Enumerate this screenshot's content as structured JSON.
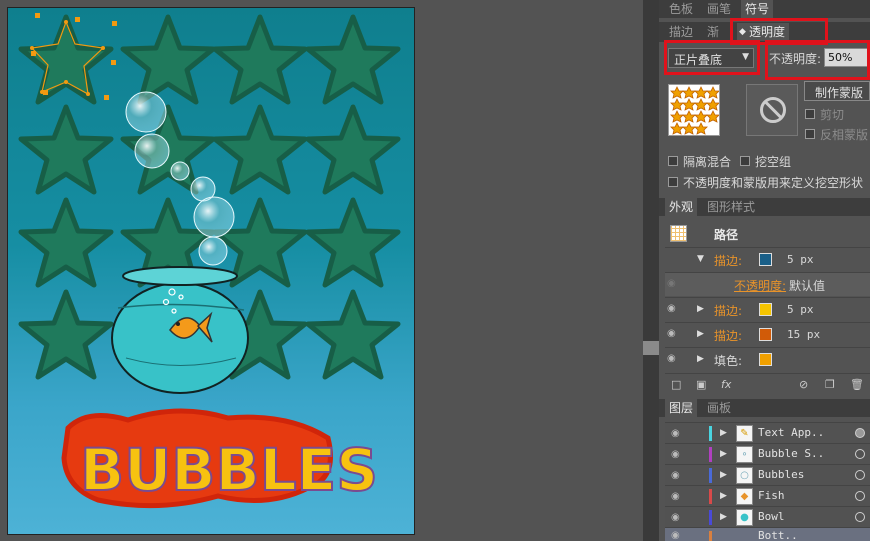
{
  "artwork": {
    "title_text": "BUBBLES"
  },
  "panel_transparency": {
    "tabs": [
      {
        "label": "色板"
      },
      {
        "label": "画笔"
      },
      {
        "label": "符号"
      }
    ],
    "sub_tabs": [
      {
        "label": "描边"
      },
      {
        "label": "渐变"
      },
      {
        "label": "透明度"
      }
    ],
    "blend_mode": "正片叠底",
    "opacity_label": "不透明度:",
    "opacity_value": "50%",
    "make_mask_label": "制作蒙版",
    "clip_label": "剪切",
    "invert_mask_label": "反相蒙版",
    "isolate_blend_label": "隔离混合",
    "knockout_group_label": "挖空组",
    "opacity_mask_knockout_label": "不透明度和蒙版用来定义挖空形状"
  },
  "panel_appearance": {
    "tabs": [
      {
        "label": "外观"
      },
      {
        "label": "图形样式"
      }
    ],
    "object_label": "路径",
    "rows": [
      {
        "label": "描边:",
        "value": "5 px",
        "color": "#1a5f88"
      },
      {
        "label": "不透明度:",
        "value": "默认值"
      },
      {
        "label": "描边:",
        "value": "5 px",
        "color": "#f5c400"
      },
      {
        "label": "描边:",
        "value": "15 px",
        "color": "#d15b08"
      },
      {
        "label": "填色:",
        "value": "",
        "color": "#f0a000"
      }
    ]
  },
  "panel_layers": {
    "tabs": [
      {
        "label": "图层"
      },
      {
        "label": "画板"
      }
    ],
    "layers": [
      {
        "name": "Text App..",
        "color": "#4ad4e0"
      },
      {
        "name": "Bubble S..",
        "color": "#b040c0"
      },
      {
        "name": "Bubbles",
        "color": "#4a6ad8"
      },
      {
        "name": "Fish",
        "color": "#d84a4a"
      },
      {
        "name": "Bowl",
        "color": "#4a4ad8"
      },
      {
        "name": "Bott..",
        "color": "#d88040"
      }
    ]
  }
}
